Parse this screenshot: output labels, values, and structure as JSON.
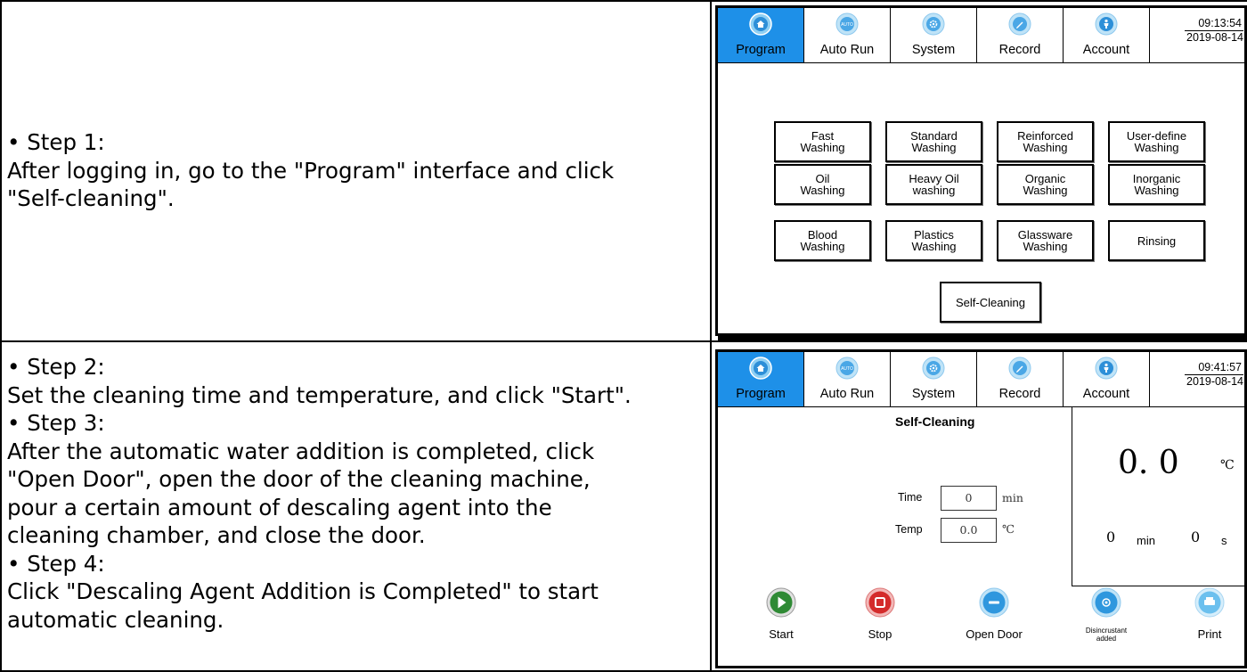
{
  "steps": {
    "row1": [
      "• Step 1:",
      "After logging in, go to the \"Program\" interface and click",
      "\"Self-cleaning\"."
    ],
    "row2": [
      "• Step 2:",
      "Set the cleaning time and temperature, and click \"Start\".",
      "• Step 3:",
      "After the automatic water addition is completed, click",
      "\"Open Door\", open the door of the cleaning machine,",
      "pour a certain amount of descaling agent into the",
      "cleaning chamber, and close the door.",
      "• Step 4:",
      "Click \"Descaling Agent Addition is Completed\" to start",
      "automatic cleaning."
    ]
  },
  "nav_tabs": [
    {
      "label": "Program",
      "icon": "home-icon",
      "icon_text": ""
    },
    {
      "label": "Auto Run",
      "icon": "auto-icon",
      "icon_text": "AUTO"
    },
    {
      "label": "System",
      "icon": "gear-icon",
      "icon_text": ""
    },
    {
      "label": "Record",
      "icon": "pencil-icon",
      "icon_text": ""
    },
    {
      "label": "Account",
      "icon": "user-icon",
      "icon_text": ""
    }
  ],
  "screen1": {
    "time": "09:13:54",
    "date": "2019-08-14",
    "programs": [
      [
        "Fast\nWashing",
        "Standard\nWashing",
        "Reinforced\nWashing",
        "User-define\nWashing"
      ],
      [
        "Oil\nWashing",
        "Heavy Oil\nwashing",
        "Organic\nWashing",
        "Inorganic\nWashing"
      ],
      [
        "Blood\nWashing",
        "Plastics\nWashing",
        "Glassware\nWashing",
        "Rinsing"
      ]
    ],
    "self_cleaning": "Self-Cleaning"
  },
  "screen2": {
    "time": "09:41:57",
    "date": "2019-08-14",
    "title": "Self-Cleaning",
    "time_label": "Time",
    "time_value": "0",
    "time_unit": "min",
    "temp_label": "Temp",
    "temp_value": "0.0",
    "temp_unit": "℃",
    "current_temp": "0. 0",
    "current_temp_unit": "℃",
    "timer_min": "0",
    "timer_min_unit": "min",
    "timer_sec": "0",
    "timer_sec_unit": "s",
    "actions": [
      {
        "label": "Start",
        "icon": "play-icon",
        "color": "#3f9a3a"
      },
      {
        "label": "Stop",
        "icon": "stop-icon",
        "color": "#d42b2b"
      },
      {
        "label": "Open Door",
        "icon": "minus-icon",
        "color": "#2f97de"
      },
      {
        "label": "Disincrustant added",
        "icon": "target-icon",
        "color": "#2f97de"
      },
      {
        "label": "Print",
        "icon": "printer-icon",
        "color": "#6cc0ee"
      }
    ]
  },
  "colors": {
    "active_tab": "#1e90e8",
    "icon_blue": "#2f97de"
  }
}
